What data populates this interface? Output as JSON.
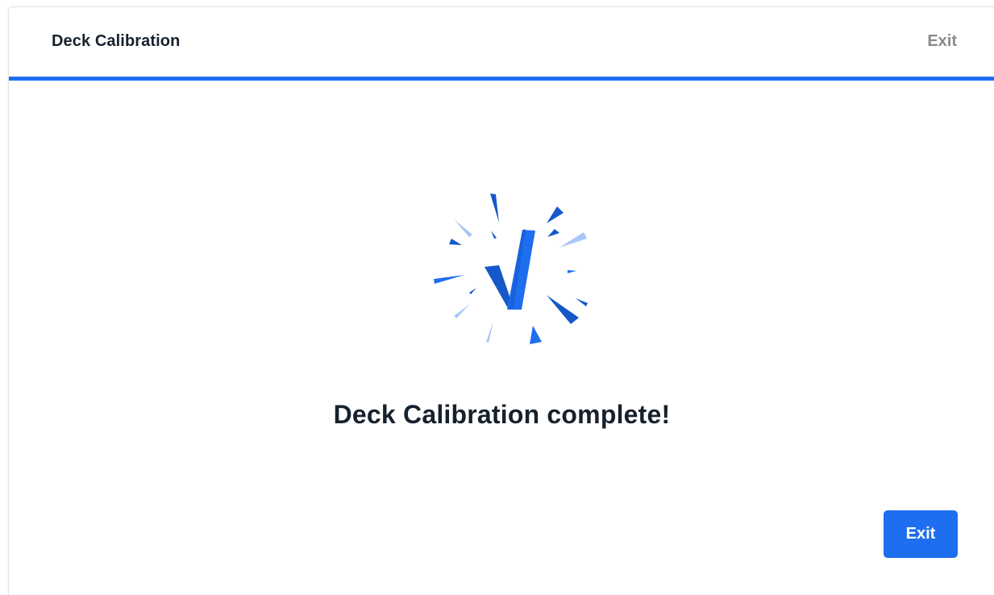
{
  "header": {
    "title": "Deck Calibration",
    "exit_label": "Exit"
  },
  "progress": {
    "fraction": 1.0,
    "color": "#1e6ef0"
  },
  "status": {
    "icon": "success-check-burst-icon",
    "message": "Deck Calibration complete!"
  },
  "footer": {
    "exit_button_label": "Exit"
  },
  "colors": {
    "accent": "#1e6ef0",
    "accent_dark": "#1558c8",
    "accent_light": "#a8c6f7",
    "text_primary": "#16212d",
    "text_muted": "#8a8a8a"
  }
}
